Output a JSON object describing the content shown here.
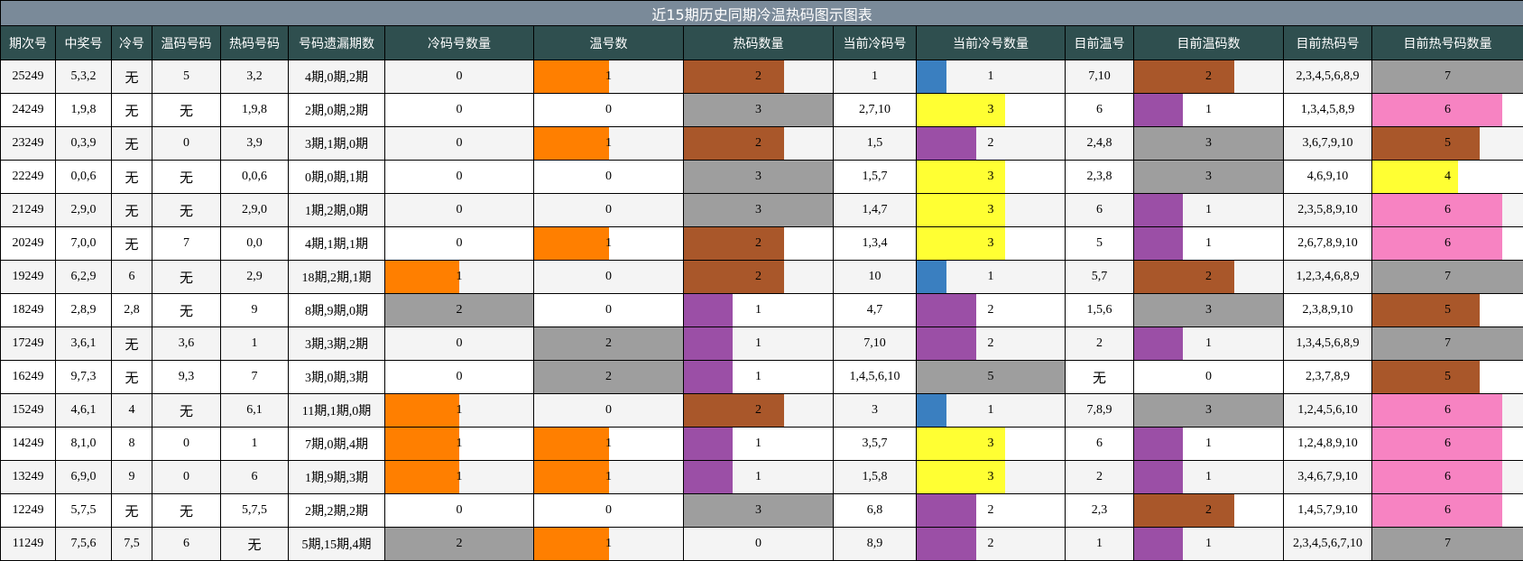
{
  "title": "近15期历史同期冷温热码图示图表",
  "headers": [
    "期次号",
    "中奖号",
    "冷号",
    "温码号码",
    "热码号码",
    "号码遗漏期数",
    "冷码号数量",
    "温号数",
    "热码数量",
    "当前冷码号",
    "当前冷号数量",
    "目前温号",
    "目前温码数",
    "目前热码号",
    "目前热号码数量"
  ],
  "colors": {
    "orange": "#ff7f00",
    "brown": "#a9572a",
    "gray": "#9e9e9e",
    "purple": "#9b4fa6",
    "yellow": "#ffff33",
    "blue": "#3a7fc0",
    "pink": "#f783c2"
  },
  "rows": [
    {
      "qi": "25249",
      "zj": "5,3,2",
      "leng": "无",
      "wen": "5",
      "re": "3,2",
      "yl": "4期,0期,2期",
      "lengNum": "0",
      "wenNum": "1",
      "reNum": "2",
      "curLeng": "1",
      "curLengNum": "1",
      "curWen": "7,10",
      "curWenNum": "2",
      "curRe": "2,3,4,5,6,8,9",
      "curReNum": "7"
    },
    {
      "qi": "24249",
      "zj": "1,9,8",
      "leng": "无",
      "wen": "无",
      "re": "1,9,8",
      "yl": "2期,0期,2期",
      "lengNum": "0",
      "wenNum": "0",
      "reNum": "3",
      "curLeng": "2,7,10",
      "curLengNum": "3",
      "curWen": "6",
      "curWenNum": "1",
      "curRe": "1,3,4,5,8,9",
      "curReNum": "6"
    },
    {
      "qi": "23249",
      "zj": "0,3,9",
      "leng": "无",
      "wen": "0",
      "re": "3,9",
      "yl": "3期,1期,0期",
      "lengNum": "0",
      "wenNum": "1",
      "reNum": "2",
      "curLeng": "1,5",
      "curLengNum": "2",
      "curWen": "2,4,8",
      "curWenNum": "3",
      "curRe": "3,6,7,9,10",
      "curReNum": "5"
    },
    {
      "qi": "22249",
      "zj": "0,0,6",
      "leng": "无",
      "wen": "无",
      "re": "0,0,6",
      "yl": "0期,0期,1期",
      "lengNum": "0",
      "wenNum": "0",
      "reNum": "3",
      "curLeng": "1,5,7",
      "curLengNum": "3",
      "curWen": "2,3,8",
      "curWenNum": "3",
      "curRe": "4,6,9,10",
      "curReNum": "4"
    },
    {
      "qi": "21249",
      "zj": "2,9,0",
      "leng": "无",
      "wen": "无",
      "re": "2,9,0",
      "yl": "1期,2期,0期",
      "lengNum": "0",
      "wenNum": "0",
      "reNum": "3",
      "curLeng": "1,4,7",
      "curLengNum": "3",
      "curWen": "6",
      "curWenNum": "1",
      "curRe": "2,3,5,8,9,10",
      "curReNum": "6"
    },
    {
      "qi": "20249",
      "zj": "7,0,0",
      "leng": "无",
      "wen": "7",
      "re": "0,0",
      "yl": "4期,1期,1期",
      "lengNum": "0",
      "wenNum": "1",
      "reNum": "2",
      "curLeng": "1,3,4",
      "curLengNum": "3",
      "curWen": "5",
      "curWenNum": "1",
      "curRe": "2,6,7,8,9,10",
      "curReNum": "6"
    },
    {
      "qi": "19249",
      "zj": "6,2,9",
      "leng": "6",
      "wen": "无",
      "re": "2,9",
      "yl": "18期,2期,1期",
      "lengNum": "1",
      "wenNum": "0",
      "reNum": "2",
      "curLeng": "10",
      "curLengNum": "1",
      "curWen": "5,7",
      "curWenNum": "2",
      "curRe": "1,2,3,4,6,8,9",
      "curReNum": "7"
    },
    {
      "qi": "18249",
      "zj": "2,8,9",
      "leng": "2,8",
      "wen": "无",
      "re": "9",
      "yl": "8期,9期,0期",
      "lengNum": "2",
      "wenNum": "0",
      "reNum": "1",
      "curLeng": "4,7",
      "curLengNum": "2",
      "curWen": "1,5,6",
      "curWenNum": "3",
      "curRe": "2,3,8,9,10",
      "curReNum": "5"
    },
    {
      "qi": "17249",
      "zj": "3,6,1",
      "leng": "无",
      "wen": "3,6",
      "re": "1",
      "yl": "3期,3期,2期",
      "lengNum": "0",
      "wenNum": "2",
      "reNum": "1",
      "curLeng": "7,10",
      "curLengNum": "2",
      "curWen": "2",
      "curWenNum": "1",
      "curRe": "1,3,4,5,6,8,9",
      "curReNum": "7"
    },
    {
      "qi": "16249",
      "zj": "9,7,3",
      "leng": "无",
      "wen": "9,3",
      "re": "7",
      "yl": "3期,0期,3期",
      "lengNum": "0",
      "wenNum": "2",
      "reNum": "1",
      "curLeng": "1,4,5,6,10",
      "curLengNum": "5",
      "curWen": "无",
      "curWenNum": "0",
      "curRe": "2,3,7,8,9",
      "curReNum": "5"
    },
    {
      "qi": "15249",
      "zj": "4,6,1",
      "leng": "4",
      "wen": "无",
      "re": "6,1",
      "yl": "11期,1期,0期",
      "lengNum": "1",
      "wenNum": "0",
      "reNum": "2",
      "curLeng": "3",
      "curLengNum": "1",
      "curWen": "7,8,9",
      "curWenNum": "3",
      "curRe": "1,2,4,5,6,10",
      "curReNum": "6"
    },
    {
      "qi": "14249",
      "zj": "8,1,0",
      "leng": "8",
      "wen": "0",
      "re": "1",
      "yl": "7期,0期,4期",
      "lengNum": "1",
      "wenNum": "1",
      "reNum": "1",
      "curLeng": "3,5,7",
      "curLengNum": "3",
      "curWen": "6",
      "curWenNum": "1",
      "curRe": "1,2,4,8,9,10",
      "curReNum": "6"
    },
    {
      "qi": "13249",
      "zj": "6,9,0",
      "leng": "9",
      "wen": "0",
      "re": "6",
      "yl": "1期,9期,3期",
      "lengNum": "1",
      "wenNum": "1",
      "reNum": "1",
      "curLeng": "1,5,8",
      "curLengNum": "3",
      "curWen": "2",
      "curWenNum": "1",
      "curRe": "3,4,6,7,9,10",
      "curReNum": "6"
    },
    {
      "qi": "12249",
      "zj": "5,7,5",
      "leng": "无",
      "wen": "无",
      "re": "5,7,5",
      "yl": "2期,2期,2期",
      "lengNum": "0",
      "wenNum": "0",
      "reNum": "3",
      "curLeng": "6,8",
      "curLengNum": "2",
      "curWen": "2,3",
      "curWenNum": "2",
      "curRe": "1,4,5,7,9,10",
      "curReNum": "6"
    },
    {
      "qi": "11249",
      "zj": "7,5,6",
      "leng": "7,5",
      "wen": "6",
      "re": "无",
      "yl": "5期,15期,4期",
      "lengNum": "2",
      "wenNum": "1",
      "reNum": "0",
      "curLeng": "8,9",
      "curLengNum": "2",
      "curWen": "1",
      "curWenNum": "1",
      "curRe": "2,3,4,5,6,7,10",
      "curReNum": "7"
    }
  ]
}
